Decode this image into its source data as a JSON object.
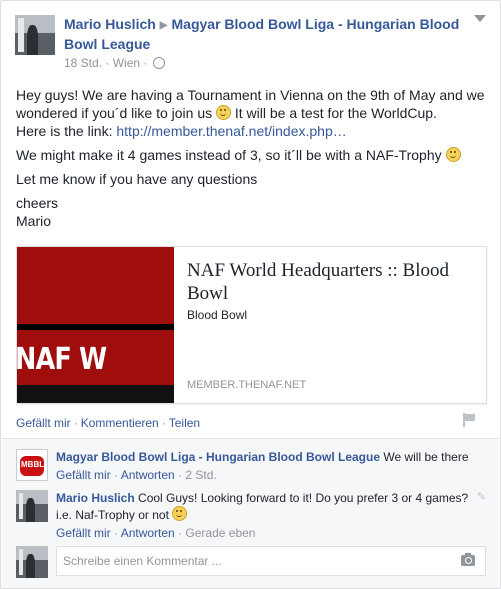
{
  "header": {
    "author": "Mario Huslich",
    "group": "Magyar Blood Bowl Liga - Hungarian Blood Bowl League",
    "time": "18 Std.",
    "location": "Wien",
    "separator": "·"
  },
  "post": {
    "line1_a": "Hey guys! We are having a Tournament in Vienna on the 9th of May and we wondered if you´d like to join us",
    "line1_b": "It will be a test for the WorldCup.",
    "line1_c": "Here is the link:",
    "link": "http://member.thenaf.net/index.php…",
    "line2": "We might make it 4 games instead of 3, so it´ll be with a NAF-Trophy",
    "line3": "Let me know if you have any questions",
    "line4": "cheers",
    "line5": "Mario"
  },
  "share": {
    "title": "NAF World Headquarters :: Blood Bowl",
    "subtitle": "Blood Bowl",
    "domain": "MEMBER.THENAF.NET",
    "image_text": "NAF W"
  },
  "actions": {
    "like": "Gefällt mir",
    "comment": "Kommentieren",
    "share": "Teilen",
    "dot": "·"
  },
  "comments": [
    {
      "author": "Magyar Blood Bowl Liga - Hungarian Blood Bowl League",
      "text": "We will be there",
      "like": "Gefällt mir",
      "reply": "Antworten",
      "time": "2 Std.",
      "avatar_text": "MBBL"
    },
    {
      "author": "Mario Huslich",
      "text": "Cool Guys! Looking forward to it! Do you prefer 3 or 4 games? i.e. Naf-Trophy or not",
      "like": "Gefällt mir",
      "reply": "Antworten",
      "time": "Gerade eben"
    }
  ],
  "composer": {
    "placeholder": "Schreibe einen Kommentar ..."
  },
  "icons": {
    "emoji": "smiley-icon",
    "globe": "globe-icon",
    "flag": "flag-icon",
    "camera": "camera-icon",
    "caret": "chevron-down-icon"
  },
  "colors": {
    "link": "#365899",
    "muted": "#90949c",
    "red": "#a00d0d"
  }
}
